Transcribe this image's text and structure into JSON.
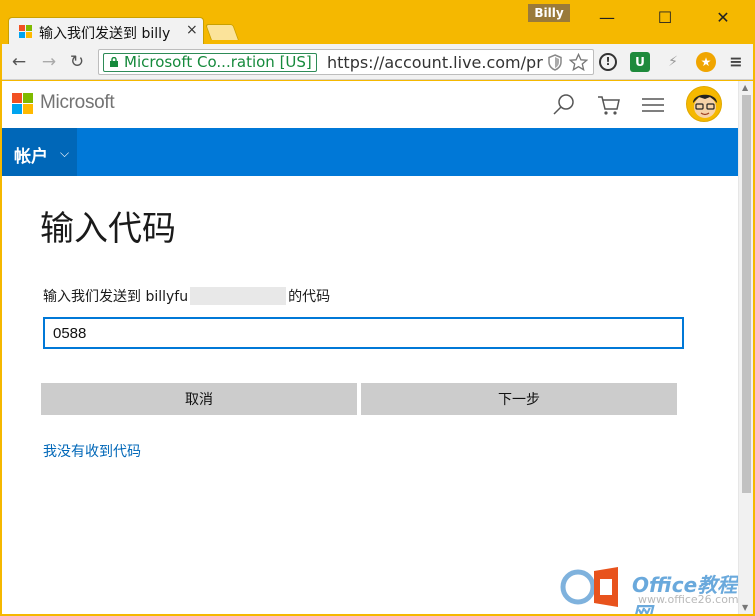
{
  "browser": {
    "tab_title": "输入我们发送到 billy",
    "tab_close": "×",
    "profile_name": "Billy",
    "window_controls": {
      "minimize": "—",
      "maximize": "☐",
      "close": "✕"
    },
    "nav": {
      "back": "←",
      "forward": "→",
      "reload": "↻"
    },
    "ev_cert": "Microsoft Co...ration [US]",
    "url": "https://account.live.com/pro",
    "omnibox_icons": [
      "shield-icon",
      "star-icon"
    ],
    "extensions": [
      "1password-icon",
      "ublock-icon",
      "flash-icon",
      "star-extension-icon",
      "menu-icon"
    ]
  },
  "header": {
    "brand": "Microsoft",
    "icons": [
      "search-icon",
      "cart-icon",
      "hamburger-menu-icon",
      "avatar"
    ]
  },
  "account_bar": {
    "label": "帐户",
    "chevron": "⌵"
  },
  "main": {
    "title": "输入代码",
    "label_prefix": "输入我们发送到 billyfu",
    "label_suffix": "的代码",
    "code_value": "0588",
    "cancel_label": "取消",
    "next_label": "下一步",
    "no_code_link": "我没有收到代码"
  },
  "watermark": {
    "title": "Office教程网",
    "url": "www.office26.com"
  },
  "colors": {
    "accent": "#0078d7",
    "frame": "#f5b800",
    "link": "#0067b8",
    "ev_green": "#168a3c"
  }
}
